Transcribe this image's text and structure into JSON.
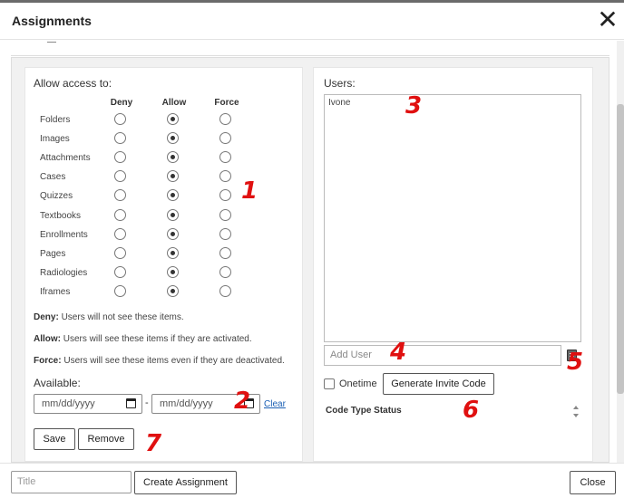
{
  "dialog": {
    "title": "Assignments",
    "close_icon": "close-icon"
  },
  "access": {
    "heading": "Allow access to:",
    "columns": [
      "Deny",
      "Allow",
      "Force"
    ],
    "rows": [
      {
        "label": "Folders",
        "selected": "Allow"
      },
      {
        "label": "Images",
        "selected": "Allow"
      },
      {
        "label": "Attachments",
        "selected": "Allow"
      },
      {
        "label": "Cases",
        "selected": "Allow"
      },
      {
        "label": "Quizzes",
        "selected": "Allow"
      },
      {
        "label": "Textbooks",
        "selected": "Allow"
      },
      {
        "label": "Enrollments",
        "selected": "Allow"
      },
      {
        "label": "Pages",
        "selected": "Allow"
      },
      {
        "label": "Radiologies",
        "selected": "Allow"
      },
      {
        "label": "Iframes",
        "selected": "Allow"
      }
    ],
    "descriptions": [
      {
        "term": "Deny:",
        "text": " Users will not see these items."
      },
      {
        "term": "Allow:",
        "text": " Users will see these items if they are activated."
      },
      {
        "term": "Force:",
        "text": " Users will see these items even if they are deactivated."
      }
    ]
  },
  "available": {
    "heading": "Available:",
    "start_placeholder": "mm/dd/yyyy",
    "separator": "-",
    "end_placeholder": "mm/dd/yyyy",
    "clear_label": "Clear"
  },
  "actions": {
    "save_label": "Save",
    "remove_label": "Remove"
  },
  "users": {
    "heading": "Users:",
    "list": [
      "Ivone"
    ],
    "add_placeholder": "Add User",
    "add_icon": "book-icon",
    "onetime_label": "Onetime",
    "generate_label": "Generate Invite Code",
    "code_status_label": "Code Type Status"
  },
  "footer": {
    "title_placeholder": "Title",
    "create_label": "Create Assignment",
    "close_label": "Close"
  },
  "annotations": [
    "1",
    "2",
    "3",
    "4",
    "5",
    "6",
    "7"
  ],
  "colors": {
    "annotation": "#e01010",
    "link": "#1a5fb4",
    "panel_bg": "#f1f1f1"
  }
}
